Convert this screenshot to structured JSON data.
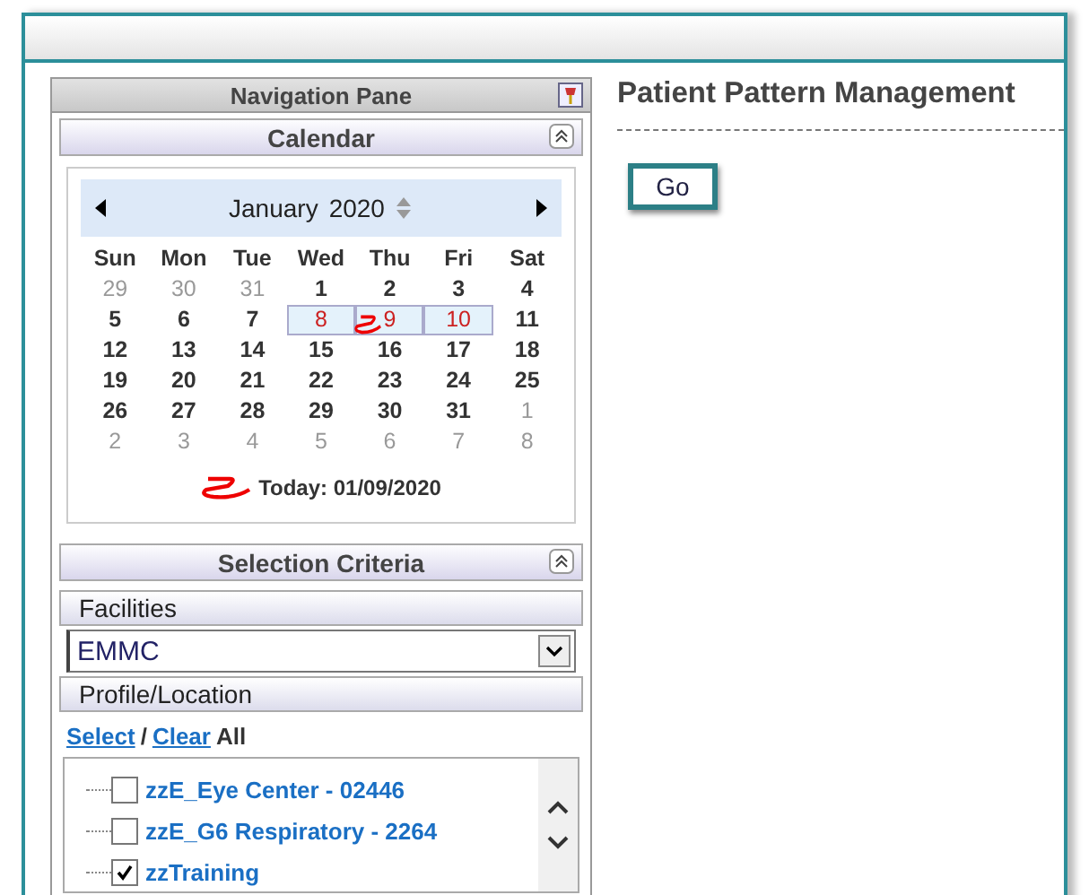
{
  "navigation_pane": {
    "title": "Navigation Pane"
  },
  "calendar": {
    "title": "Calendar",
    "month": "January",
    "year": "2020",
    "weekdays": [
      "Sun",
      "Mon",
      "Tue",
      "Wed",
      "Thu",
      "Fri",
      "Sat"
    ],
    "weeks": [
      [
        {
          "day": "29",
          "muted": true,
          "selected": false
        },
        {
          "day": "30",
          "muted": true,
          "selected": false
        },
        {
          "day": "31",
          "muted": true,
          "selected": false
        },
        {
          "day": "1",
          "muted": false,
          "selected": false
        },
        {
          "day": "2",
          "muted": false,
          "selected": false
        },
        {
          "day": "3",
          "muted": false,
          "selected": false
        },
        {
          "day": "4",
          "muted": false,
          "selected": false
        }
      ],
      [
        {
          "day": "5",
          "muted": false,
          "selected": false
        },
        {
          "day": "6",
          "muted": false,
          "selected": false
        },
        {
          "day": "7",
          "muted": false,
          "selected": false
        },
        {
          "day": "8",
          "muted": false,
          "selected": true
        },
        {
          "day": "9",
          "muted": false,
          "selected": true
        },
        {
          "day": "10",
          "muted": false,
          "selected": true
        },
        {
          "day": "11",
          "muted": false,
          "selected": false
        }
      ],
      [
        {
          "day": "12",
          "muted": false,
          "selected": false
        },
        {
          "day": "13",
          "muted": false,
          "selected": false
        },
        {
          "day": "14",
          "muted": false,
          "selected": false
        },
        {
          "day": "15",
          "muted": false,
          "selected": false
        },
        {
          "day": "16",
          "muted": false,
          "selected": false
        },
        {
          "day": "17",
          "muted": false,
          "selected": false
        },
        {
          "day": "18",
          "muted": false,
          "selected": false
        }
      ],
      [
        {
          "day": "19",
          "muted": false,
          "selected": false
        },
        {
          "day": "20",
          "muted": false,
          "selected": false
        },
        {
          "day": "21",
          "muted": false,
          "selected": false
        },
        {
          "day": "22",
          "muted": false,
          "selected": false
        },
        {
          "day": "23",
          "muted": false,
          "selected": false
        },
        {
          "day": "24",
          "muted": false,
          "selected": false
        },
        {
          "day": "25",
          "muted": false,
          "selected": false
        }
      ],
      [
        {
          "day": "26",
          "muted": false,
          "selected": false
        },
        {
          "day": "27",
          "muted": false,
          "selected": false
        },
        {
          "day": "28",
          "muted": false,
          "selected": false
        },
        {
          "day": "29",
          "muted": false,
          "selected": false
        },
        {
          "day": "30",
          "muted": false,
          "selected": false
        },
        {
          "day": "31",
          "muted": false,
          "selected": false
        },
        {
          "day": "1",
          "muted": true,
          "selected": false
        }
      ],
      [
        {
          "day": "2",
          "muted": true,
          "selected": false
        },
        {
          "day": "3",
          "muted": true,
          "selected": false
        },
        {
          "day": "4",
          "muted": true,
          "selected": false
        },
        {
          "day": "5",
          "muted": true,
          "selected": false
        },
        {
          "day": "6",
          "muted": true,
          "selected": false
        },
        {
          "day": "7",
          "muted": true,
          "selected": false
        },
        {
          "day": "8",
          "muted": true,
          "selected": false
        }
      ]
    ],
    "today": "Today: 01/09/2020"
  },
  "selection_criteria": {
    "title": "Selection Criteria",
    "facilities_label": "Facilities",
    "facility": "EMMC",
    "profile_label": "Profile/Location",
    "select_link": "Select",
    "separator": "/",
    "clear_link": "Clear",
    "all_text": "All",
    "locations": [
      {
        "label": "zzE_Eye Center - 02446",
        "checked": false
      },
      {
        "label": "zzE_G6 Respiratory - 2264",
        "checked": false
      },
      {
        "label": "zzTraining",
        "checked": true
      }
    ]
  },
  "main": {
    "title": "Patient Pattern Management",
    "go_button": "Go"
  }
}
